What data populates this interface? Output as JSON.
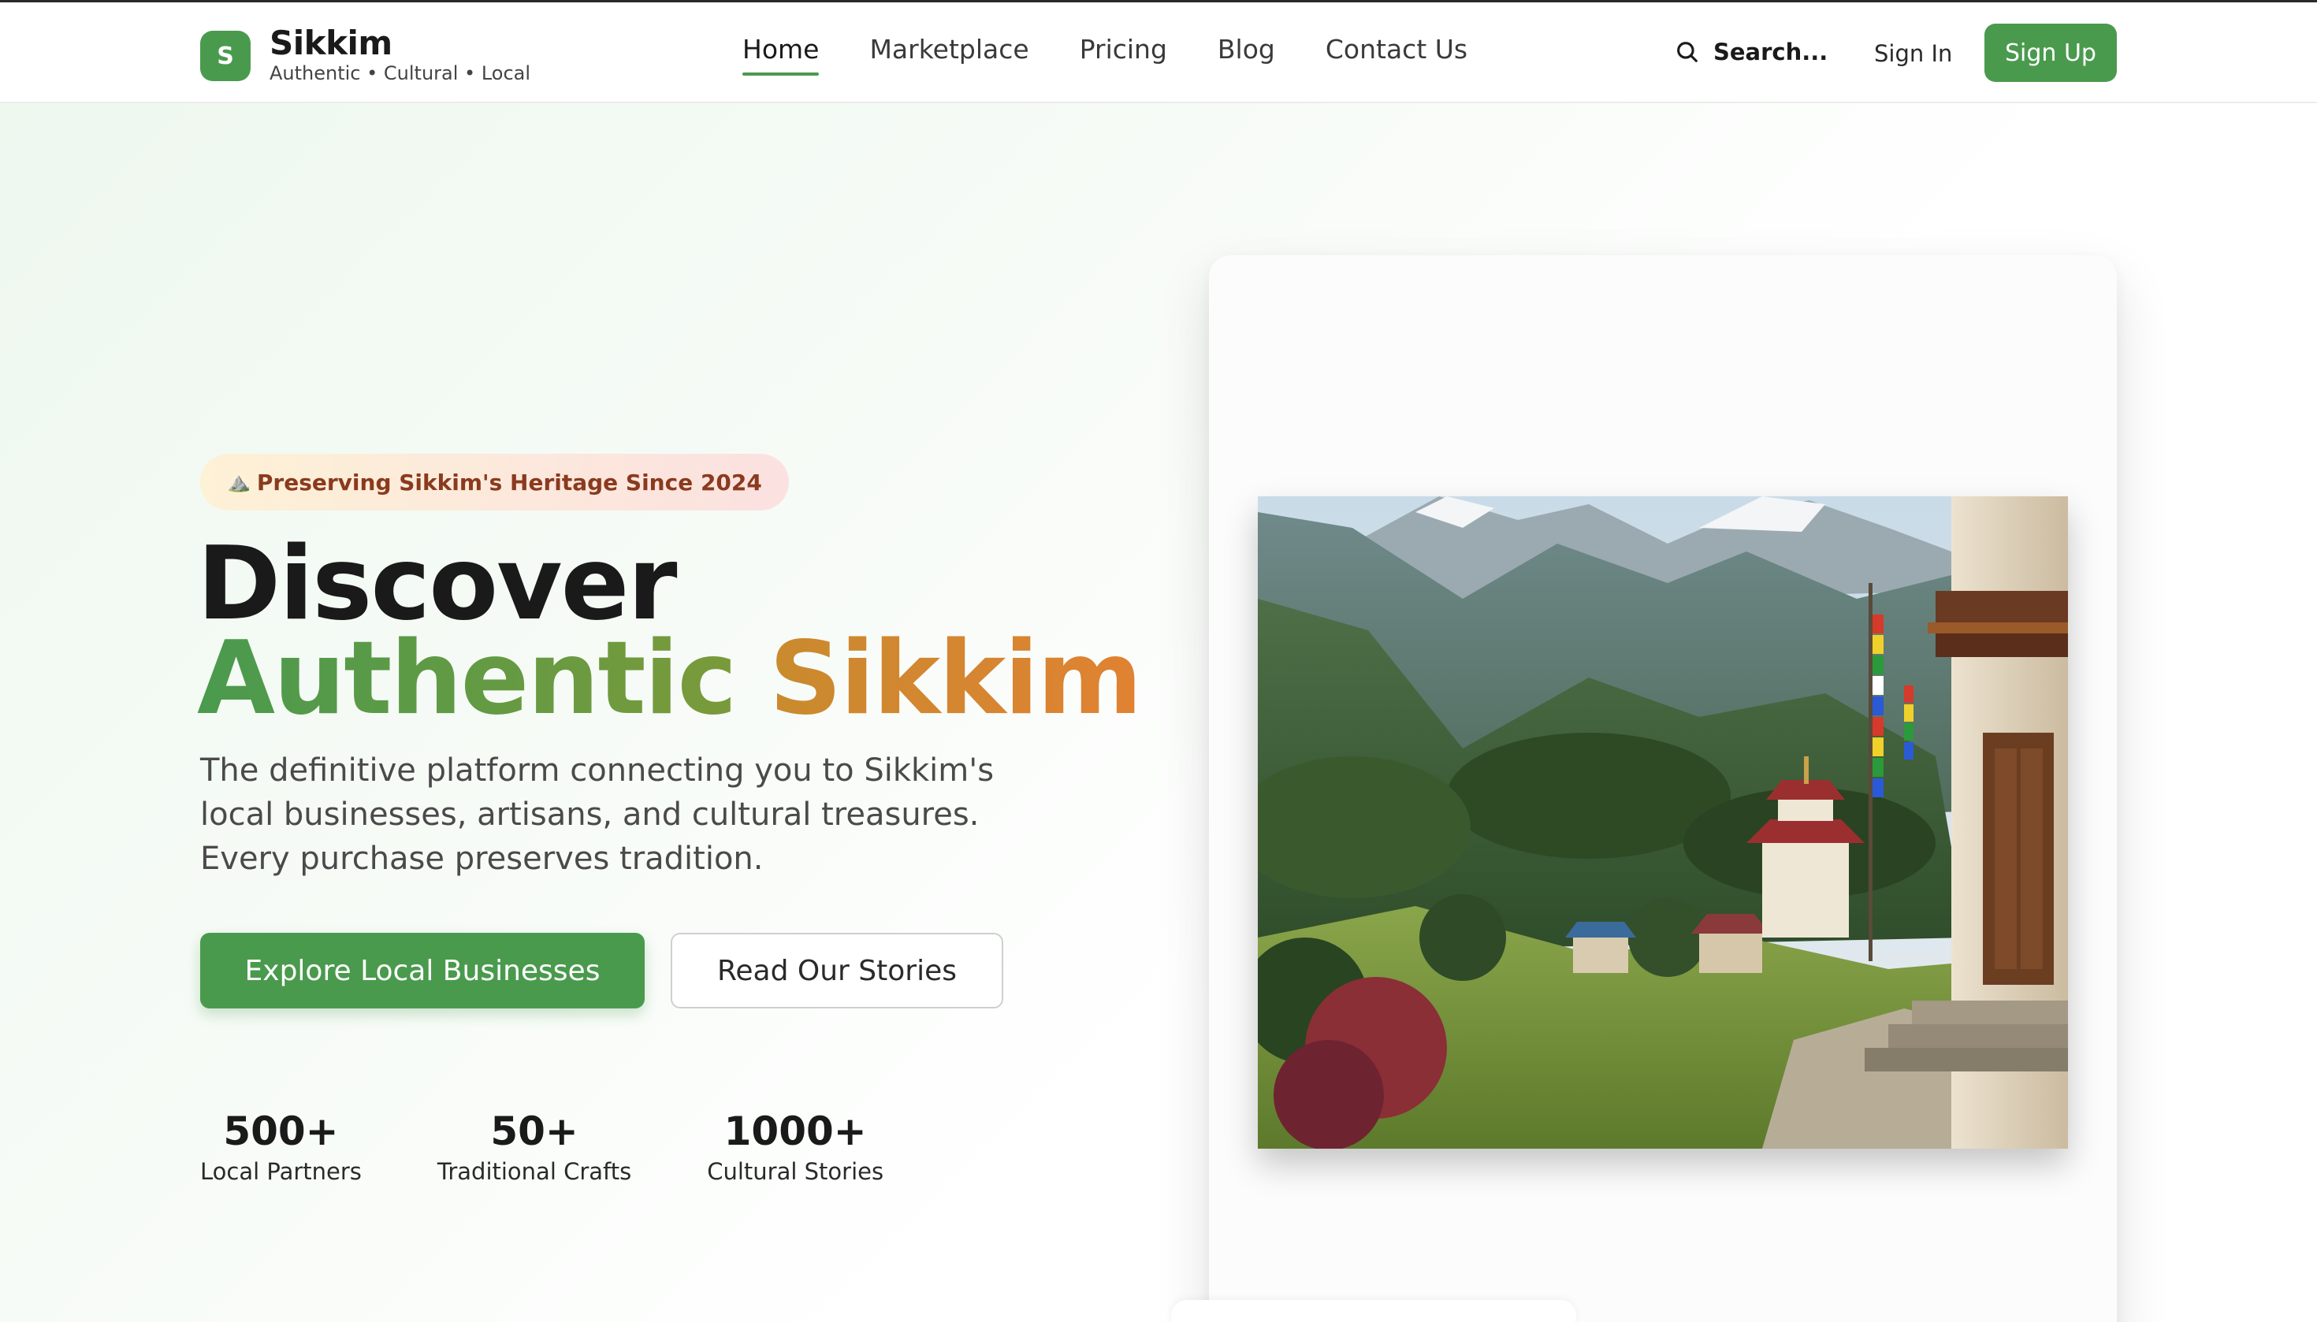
{
  "header": {
    "brand": {
      "logo_letter": "S",
      "name": "Sikkim",
      "tagline": "Authentic • Cultural • Local"
    },
    "nav": [
      {
        "label": "Home",
        "active": true
      },
      {
        "label": "Marketplace",
        "active": false
      },
      {
        "label": "Pricing",
        "active": false
      },
      {
        "label": "Blog",
        "active": false
      },
      {
        "label": "Contact Us",
        "active": false
      }
    ],
    "search": {
      "label": "Search...",
      "icon": "search-icon"
    },
    "sign_in": "Sign In",
    "sign_up": "Sign Up"
  },
  "hero": {
    "badge": {
      "icon": "⛰️",
      "text": "Preserving Sikkim's Heritage Since 2024"
    },
    "headline_line1": "Discover",
    "headline_word1": "Authentic",
    "headline_word2": "Sikkim",
    "subtext": "The definitive platform connecting you to Sikkim's local businesses, artisans, and cultural treasures. Every purchase preserves tradition.",
    "primary_cta": "Explore Local Businesses",
    "secondary_cta": "Read Our Stories",
    "stats": [
      {
        "value": "500+",
        "label": "Local Partners"
      },
      {
        "value": "50+",
        "label": "Traditional Crafts"
      },
      {
        "value": "1000+",
        "label": "Cultural Stories"
      }
    ]
  },
  "colors": {
    "accent_green": "#4a9a4e",
    "accent_orange": "#d9822b",
    "badge_text": "#8a3a1e"
  }
}
